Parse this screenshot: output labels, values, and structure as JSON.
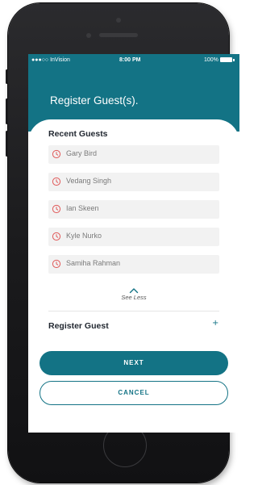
{
  "status_bar": {
    "carrier": "●●●○○ InVision",
    "time": "8:00 PM",
    "battery": "100%"
  },
  "header": {
    "title": "Register Guest(s)."
  },
  "recent_guests": {
    "title": "Recent Guests",
    "items": [
      {
        "name": "Gary Bird"
      },
      {
        "name": "Vedang Singh"
      },
      {
        "name": "Ian Skeen"
      },
      {
        "name": "Kyle Nurko"
      },
      {
        "name": "Samiha Rahman"
      }
    ],
    "toggle_label": "See Less"
  },
  "register_guest": {
    "title": "Register Guest",
    "add_symbol": "+"
  },
  "actions": {
    "next_label": "NEXT",
    "cancel_label": "CANCEL"
  },
  "colors": {
    "primary": "#137385",
    "guest_icon": "#e05a5a"
  }
}
